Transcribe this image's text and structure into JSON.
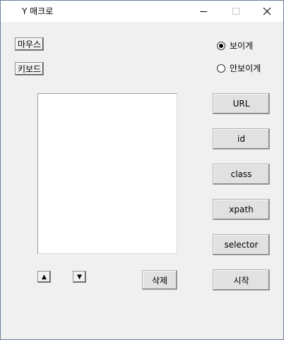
{
  "window": {
    "title": "Y 매크로"
  },
  "left_buttons": {
    "mouse": "마우스",
    "keyboard": "키보드"
  },
  "visibility": {
    "options": [
      {
        "label": "보이게",
        "selected": true
      },
      {
        "label": "안보이게",
        "selected": false
      }
    ]
  },
  "selector_buttons": {
    "url": "URL",
    "id": "id",
    "class": "class",
    "xpath": "xpath",
    "selector": "selector"
  },
  "list_controls": {
    "up": "▲",
    "down": "▼",
    "delete": "삭제"
  },
  "start_button": "시작"
}
